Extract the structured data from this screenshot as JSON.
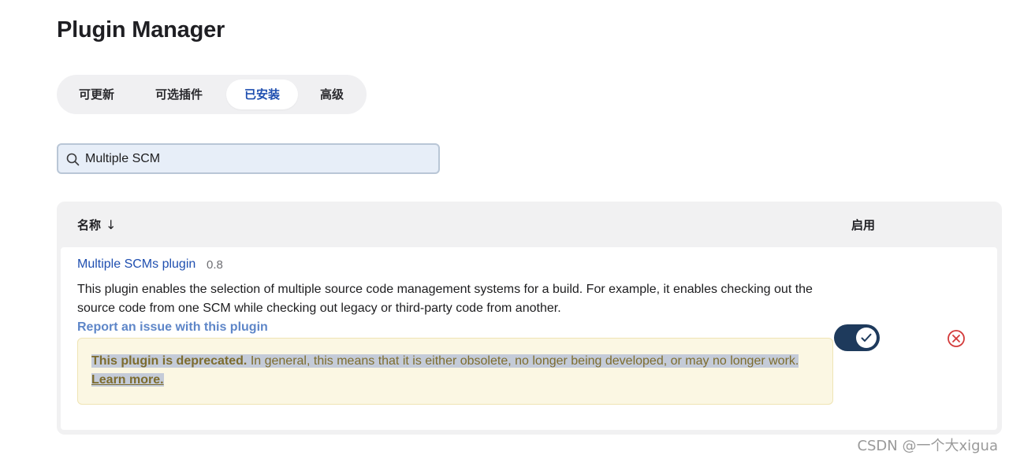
{
  "page": {
    "title": "Plugin Manager"
  },
  "tabs": [
    {
      "label": "可更新",
      "active": false
    },
    {
      "label": "可选插件",
      "active": false
    },
    {
      "label": "已安装",
      "active": true
    },
    {
      "label": "高级",
      "active": false
    }
  ],
  "search": {
    "value": "Multiple SCM",
    "icon": "search-icon"
  },
  "table": {
    "columns": {
      "name": "名称",
      "sort_arrow": "↓",
      "enabled": "启用"
    },
    "rows": [
      {
        "name": "Multiple SCMs plugin",
        "version": "0.8",
        "description": "This plugin enables the selection of multiple source code management systems for a build. For example, it enables checking out the source code from one SCM while checking out legacy or third-party code from another.",
        "report_link": "Report an issue with this plugin",
        "warning": {
          "bold": "This plugin is deprecated.",
          "text": " In general, this means that it is either obsolete, no longer being developed, or may no longer work.",
          "learn_more": "Learn more."
        },
        "enabled": true
      }
    ]
  },
  "colors": {
    "accent": "#1f4fb0",
    "toggle_on": "#1e3a5c",
    "warning_bg": "#fbf7e3",
    "warning_text": "#7d6c2e",
    "danger": "#d33a3a"
  },
  "watermark": "CSDN @一个大xigua"
}
